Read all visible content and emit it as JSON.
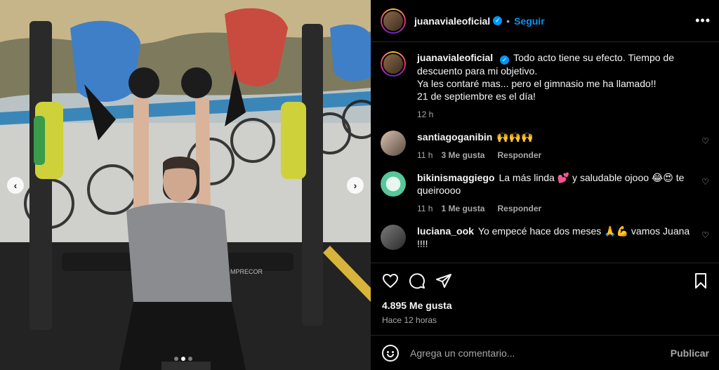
{
  "post": {
    "author": "juanavialeoficial",
    "follow_label": "Seguir",
    "separator": "•",
    "more_label": "•••",
    "image_alt": "Mujer entrenando con mancuernas en el gimnasio"
  },
  "caption": {
    "username": "juanavialeoficial",
    "lines": [
      "Todo acto tiene su efecto. Tiempo de descuento para mi objetivo.",
      "Ya les contaré mas... pero el gimnasio me ha llamado!!",
      "21 de septiembre es el día!"
    ],
    "time": "12 h"
  },
  "comments": [
    {
      "username": "santiagoganibin",
      "text": "🙌🙌🙌",
      "time": "11 h",
      "likes": "3 Me gusta",
      "reply": "Responder"
    },
    {
      "username": "bikinismaggiego",
      "text": "La más linda 💕 y saludable ojooo 😂😍 te queiroooo",
      "time": "11 h",
      "likes": "1 Me gusta",
      "reply": "Responder"
    },
    {
      "username": "luciana_ook",
      "text": "Yo empecé hace dos meses 🙏💪 vamos Juana !!!!",
      "time": "",
      "likes": "",
      "reply": ""
    }
  ],
  "stats": {
    "likes": "4.895 Me gusta",
    "posted": "Hace 12 horas"
  },
  "composer": {
    "placeholder": "Agrega un comentario...",
    "publish": "Publicar"
  },
  "carousel": {
    "total": 3,
    "active_index": 1
  },
  "colors": {
    "accent": "#0095f6",
    "background": "#000000",
    "muted": "#a8a8a8"
  },
  "gym_brand": "MPRECOR"
}
